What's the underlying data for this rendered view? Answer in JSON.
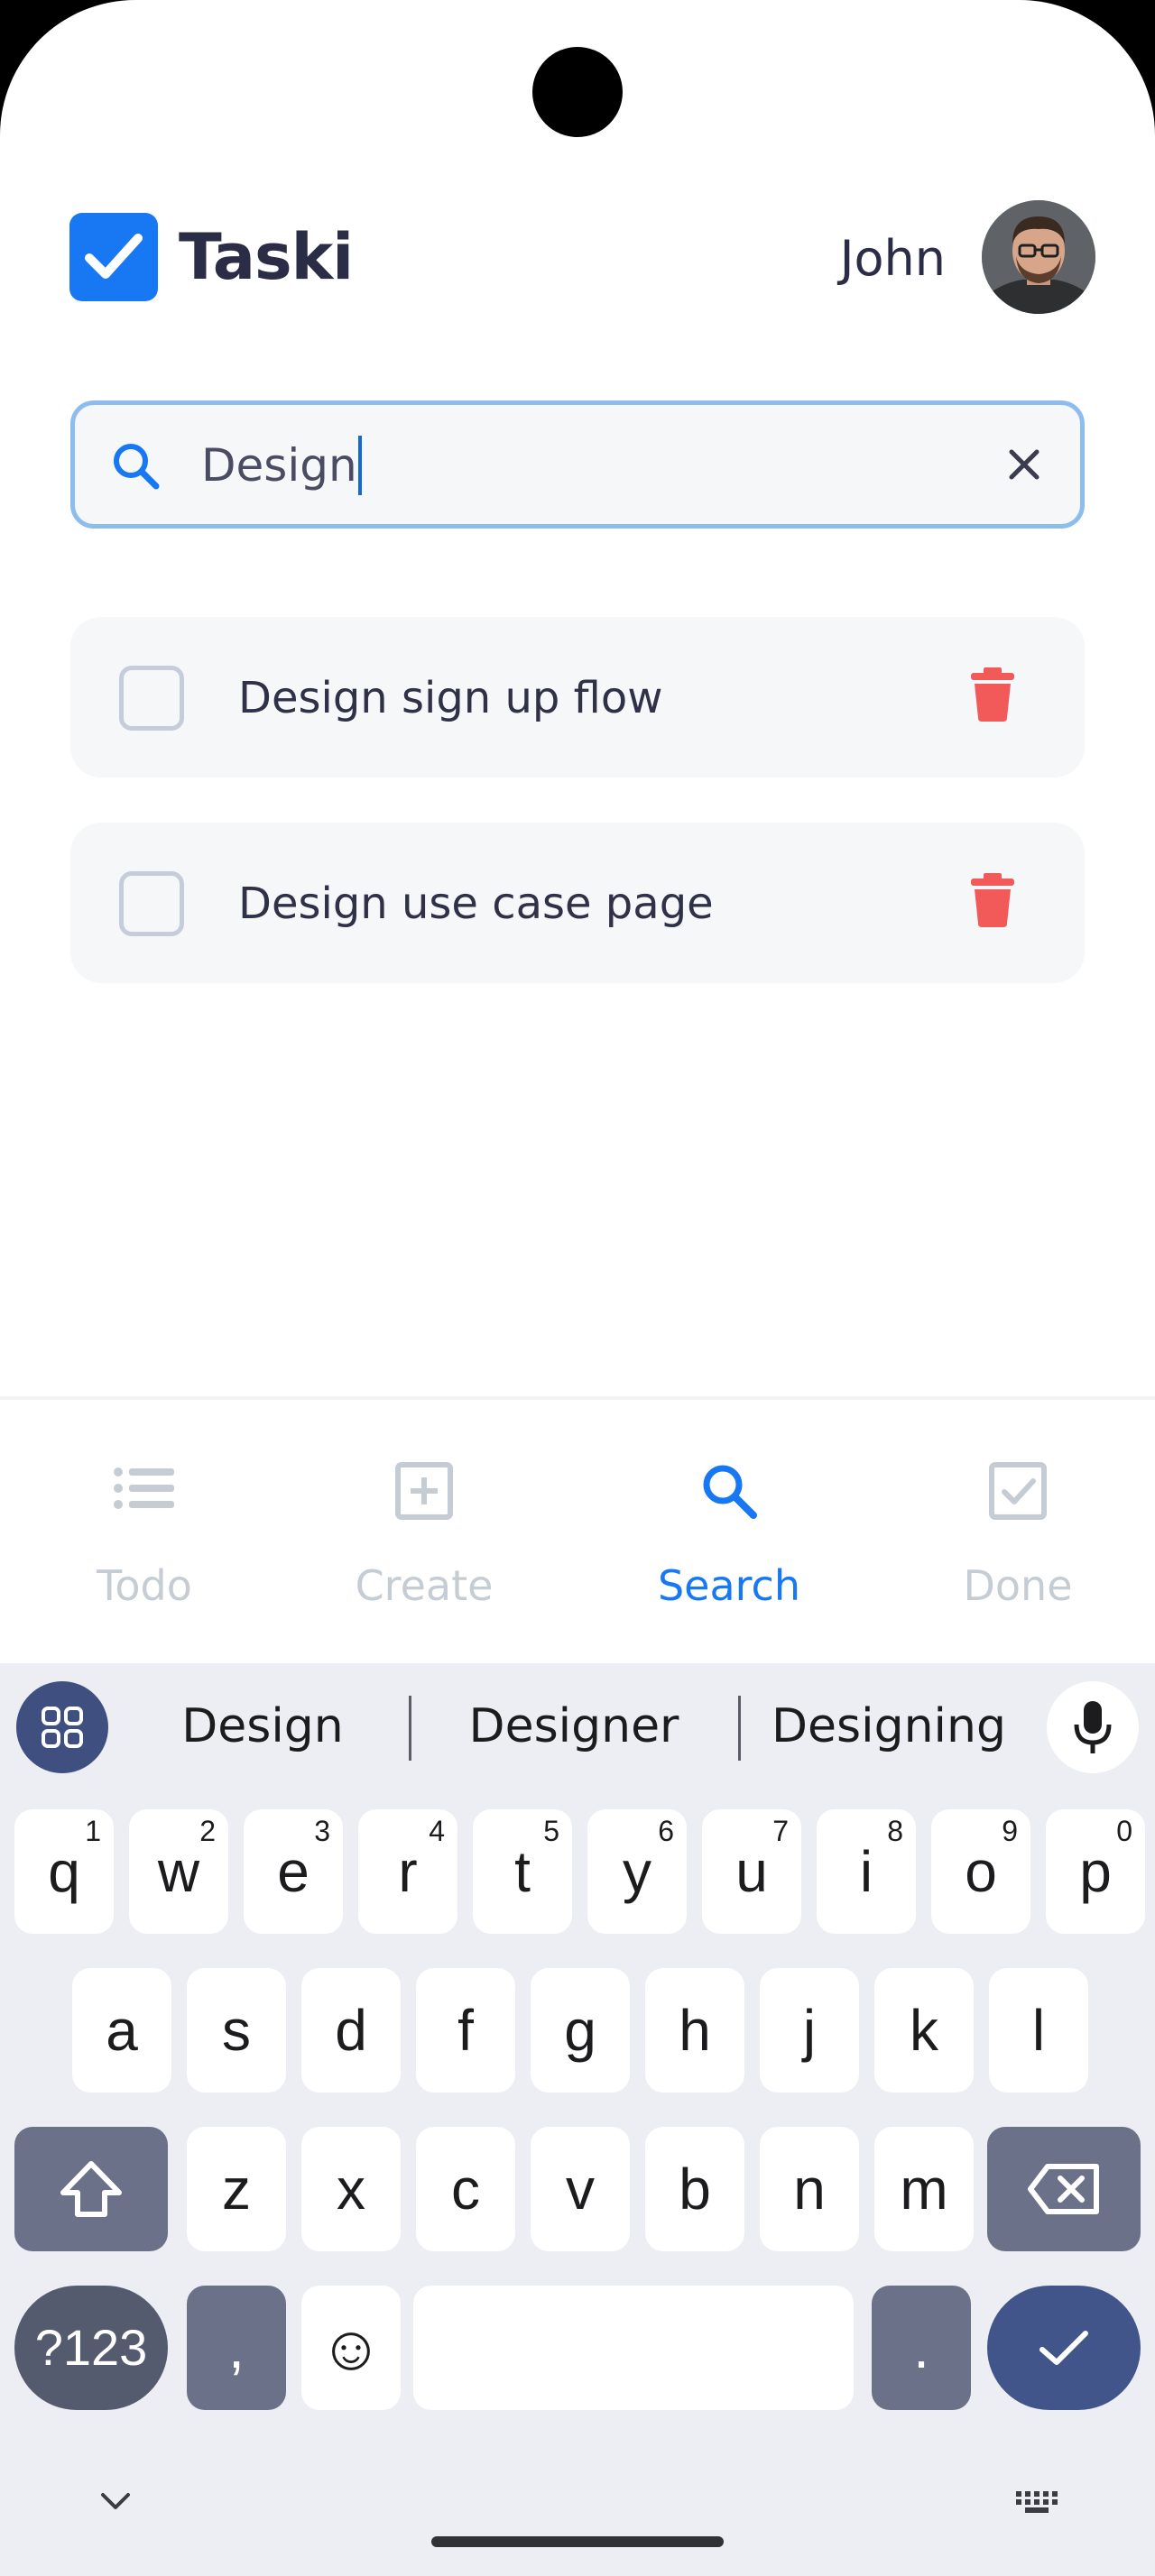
{
  "header": {
    "app_title": "Taski",
    "user_name": "John"
  },
  "search": {
    "value": "Design"
  },
  "tasks": [
    {
      "label": "Design sign up flow",
      "done": false
    },
    {
      "label": "Design use case page",
      "done": false
    }
  ],
  "nav": {
    "items": [
      {
        "label": "Todo",
        "icon": "list-icon",
        "active": false
      },
      {
        "label": "Create",
        "icon": "plus-square-icon",
        "active": false
      },
      {
        "label": "Search",
        "icon": "search-icon",
        "active": true
      },
      {
        "label": "Done",
        "icon": "check-square-icon",
        "active": false
      }
    ]
  },
  "keyboard": {
    "suggestions": [
      "Design",
      "Designer",
      "Designing"
    ],
    "row1": [
      {
        "k": "q",
        "h": "1"
      },
      {
        "k": "w",
        "h": "2"
      },
      {
        "k": "e",
        "h": "3"
      },
      {
        "k": "r",
        "h": "4"
      },
      {
        "k": "t",
        "h": "5"
      },
      {
        "k": "y",
        "h": "6"
      },
      {
        "k": "u",
        "h": "7"
      },
      {
        "k": "i",
        "h": "8"
      },
      {
        "k": "o",
        "h": "9"
      },
      {
        "k": "p",
        "h": "0"
      }
    ],
    "row2": [
      "a",
      "s",
      "d",
      "f",
      "g",
      "h",
      "j",
      "k",
      "l"
    ],
    "row3": [
      "z",
      "x",
      "c",
      "v",
      "b",
      "n",
      "m"
    ],
    "symbols_label": "?123",
    "comma_label": ",",
    "period_label": ".",
    "emoji": "☺"
  },
  "colors": {
    "accent": "#1877f2",
    "danger": "#f25a5a",
    "text": "#2b2c45",
    "muted": "#c6ccd4"
  }
}
